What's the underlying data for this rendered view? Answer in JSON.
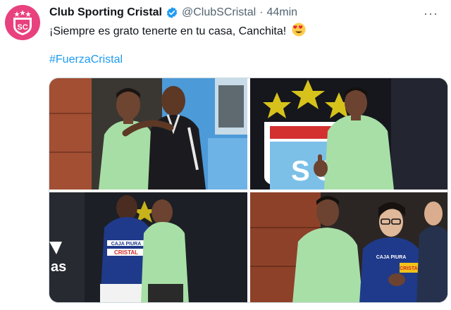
{
  "tweet": {
    "author_name": "Club Sporting Cristal",
    "handle": "@ClubSCristal",
    "separator": "·",
    "time": "44min",
    "text": "¡Siempre es grato tenerte en tu casa, Canchita!",
    "hashtag": "#FuerzaCristal",
    "more_label": "···"
  },
  "icons": {
    "avatar": "sporting-cristal-crest-icon",
    "verified": "verified-badge-icon",
    "emoji": "heart-eyes-emoji-icon"
  },
  "photos": {
    "p3_sponsor": "CRISTAL",
    "p3_jersey_brand": "CAJA PIURA",
    "p4_sponsor": "CRISTAL",
    "p4_jersey_brand": "CAJA PIURA"
  },
  "colors": {
    "accent": "#1d9bf0",
    "club_pink": "#e8417e",
    "verified": "#1d9bf0"
  }
}
